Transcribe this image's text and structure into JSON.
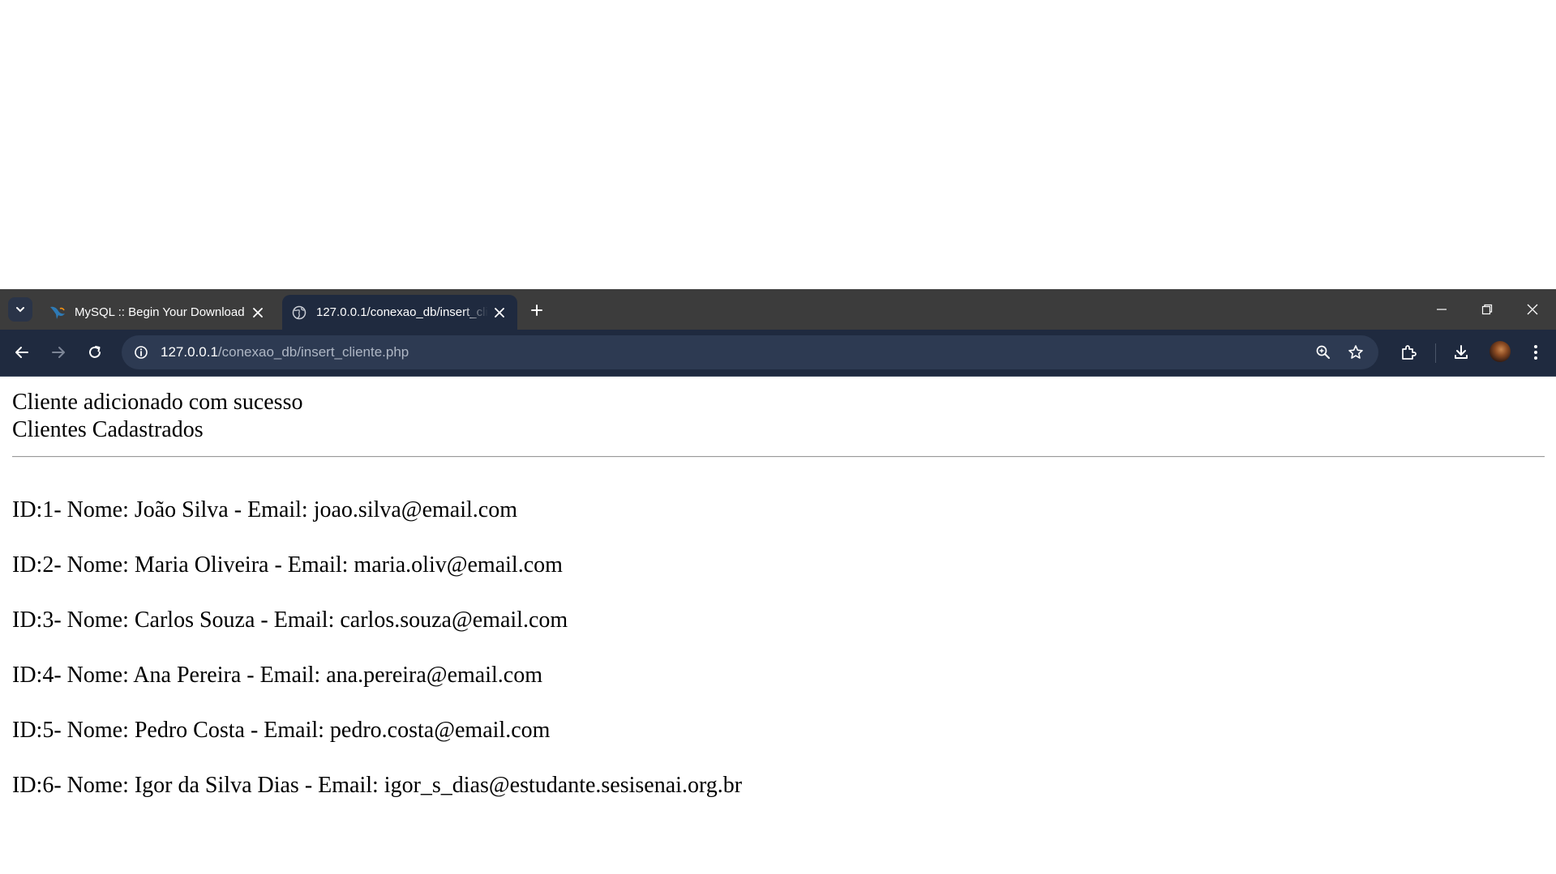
{
  "browser": {
    "tabs": [
      {
        "title": "MySQL :: Begin Your Download",
        "favicon": "mysql-dolphin-icon",
        "active": false
      },
      {
        "title": "127.0.0.1/conexao_db/insert_cliente.php",
        "favicon": "globe-icon",
        "active": true
      }
    ],
    "address_bar": {
      "host": "127.0.0.1",
      "path": "/conexao_db/insert_cliente.php"
    }
  },
  "page": {
    "status_message": "Cliente adicionado com sucesso",
    "heading": "Clientes Cadastrados",
    "clients": [
      "ID:1- Nome: João Silva - Email: joao.silva@email.com",
      "ID:2- Nome: Maria Oliveira - Email: maria.oliv@email.com",
      "ID:3- Nome: Carlos Souza - Email: carlos.souza@email.com",
      "ID:4- Nome: Ana Pereira - Email: ana.pereira@email.com",
      "ID:5- Nome: Pedro Costa - Email: pedro.costa@email.com",
      "ID:6- Nome: Igor da Silva Dias - Email: igor_s_dias@estudante.sesisenai.org.br"
    ]
  },
  "colors": {
    "tabstrip_bg": "#3c3c3c",
    "toolbar_bg": "#1f2a3f",
    "omnibox_bg": "#2d3a52",
    "page_bg": "#ffffff",
    "text": "#000000"
  }
}
